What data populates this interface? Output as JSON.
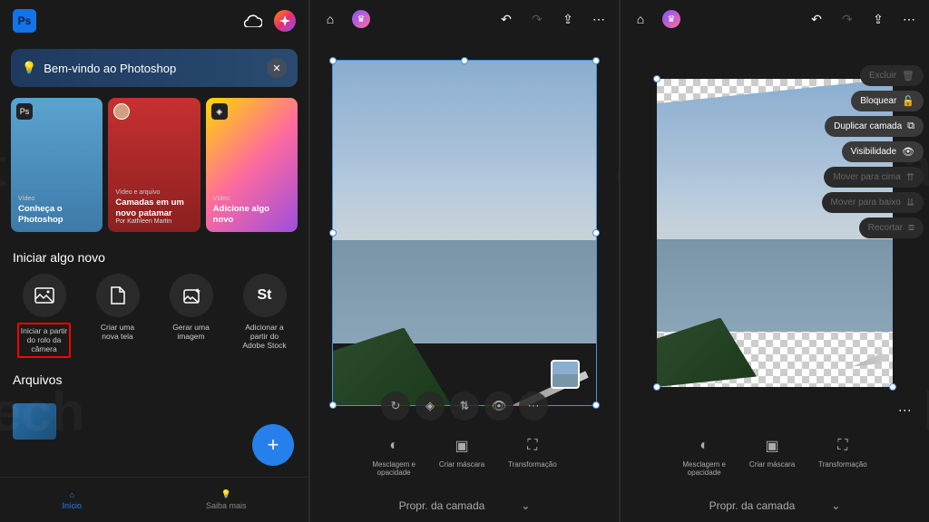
{
  "panel1": {
    "app_logo": "Ps",
    "welcome_title": "Bem-vindo ao Photoshop",
    "cards": [
      {
        "tag": "Vídeo",
        "title": "Conheça o\nPhotoshop"
      },
      {
        "tag": "Vídeo e arquivo",
        "title": "Camadas em um\nnovo patamar",
        "sub": "Por Kathleen Martin"
      },
      {
        "tag": "Vídeo",
        "title": "Adicione algo\nnovo"
      }
    ],
    "start_new_title": "Iniciar algo novo",
    "new_options": [
      {
        "label": "Iniciar a partir\ndo rolo da\ncâmera"
      },
      {
        "label": "Criar uma\nnova tela"
      },
      {
        "label": "Gerar uma\nimagem"
      },
      {
        "label": "Adicionar a\npartir do\nAdobe Stock",
        "icon_text": "St"
      }
    ],
    "files_title": "Arquivos",
    "nav": {
      "home": "Início",
      "more": "Saiba mais"
    }
  },
  "panel2": {
    "tools": {
      "blend": "Mesclagem e\nopacidade",
      "mask": "Criar máscara",
      "transform": "Transformação"
    },
    "layer_props": "Propr. da camada"
  },
  "panel3": {
    "context_menu": [
      {
        "label": "Excluir",
        "disabled": true
      },
      {
        "label": "Bloquear",
        "disabled": false
      },
      {
        "label": "Duplicar camada",
        "disabled": false
      },
      {
        "label": "Visibilidade",
        "disabled": false
      },
      {
        "label": "Mover para cima",
        "disabled": true
      },
      {
        "label": "Mover para baixo",
        "disabled": true
      },
      {
        "label": "Recortar",
        "disabled": true
      }
    ],
    "tools": {
      "blend": "Mesclagem e\nopacidade",
      "mask": "Criar máscara",
      "transform": "Transformação"
    },
    "layer_props": "Propr. da camada"
  }
}
